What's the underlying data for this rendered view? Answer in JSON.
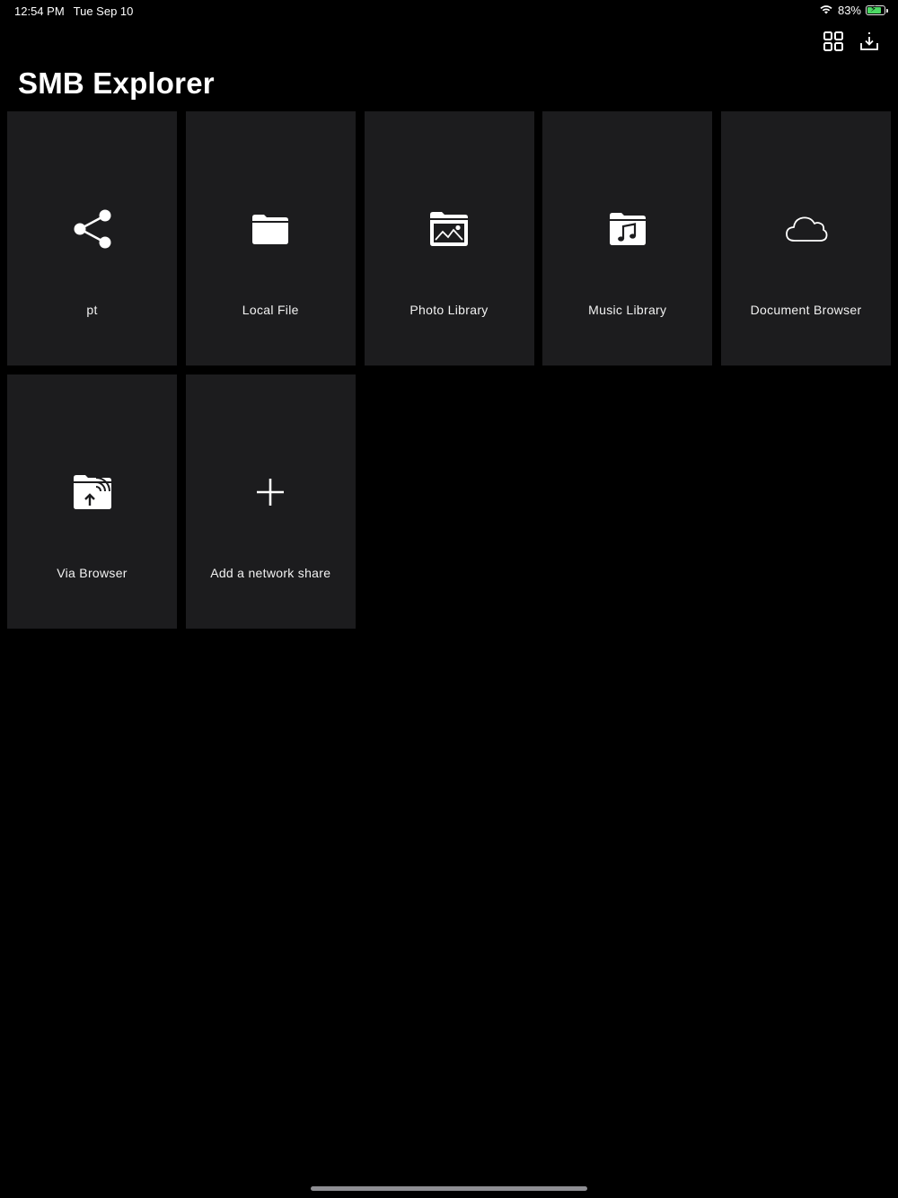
{
  "status_bar": {
    "time": "12:54 PM",
    "date": "Tue Sep 10",
    "battery_percent": "83%",
    "battery_level": 0.83,
    "battery_color": "#4cd964"
  },
  "toolbar": {
    "grid_icon": "grid-view-icon",
    "download_icon": "download-icon"
  },
  "page": {
    "title": "SMB Explorer"
  },
  "tiles": [
    {
      "label": "pt",
      "icon": "share-network-icon"
    },
    {
      "label": "Local File",
      "icon": "folder-icon"
    },
    {
      "label": "Photo Library",
      "icon": "photo-folder-icon"
    },
    {
      "label": "Music Library",
      "icon": "music-folder-icon"
    },
    {
      "label": "Document Browser",
      "icon": "cloud-icon"
    },
    {
      "label": "Via Browser",
      "icon": "wireless-upload-folder-icon"
    },
    {
      "label": "Add a network share",
      "icon": "plus-icon"
    }
  ],
  "colors": {
    "background": "#000000",
    "tile_background": "#1c1c1e",
    "text": "#ffffff"
  }
}
